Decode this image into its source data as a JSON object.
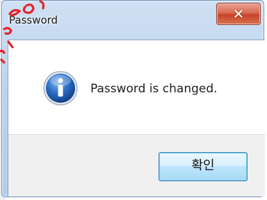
{
  "dialog": {
    "title": "Password",
    "message": "Password is changed.",
    "ok_label": "확인",
    "close_symbol": "✕"
  },
  "icons": {
    "message_icon": "info-icon",
    "close_icon": "close-icon"
  },
  "colors": {
    "close_button": "#c7442a",
    "info_blue": "#1f5fb8",
    "ok_button_border": "#3c7fb1",
    "watermark_red": "#e2232a"
  }
}
